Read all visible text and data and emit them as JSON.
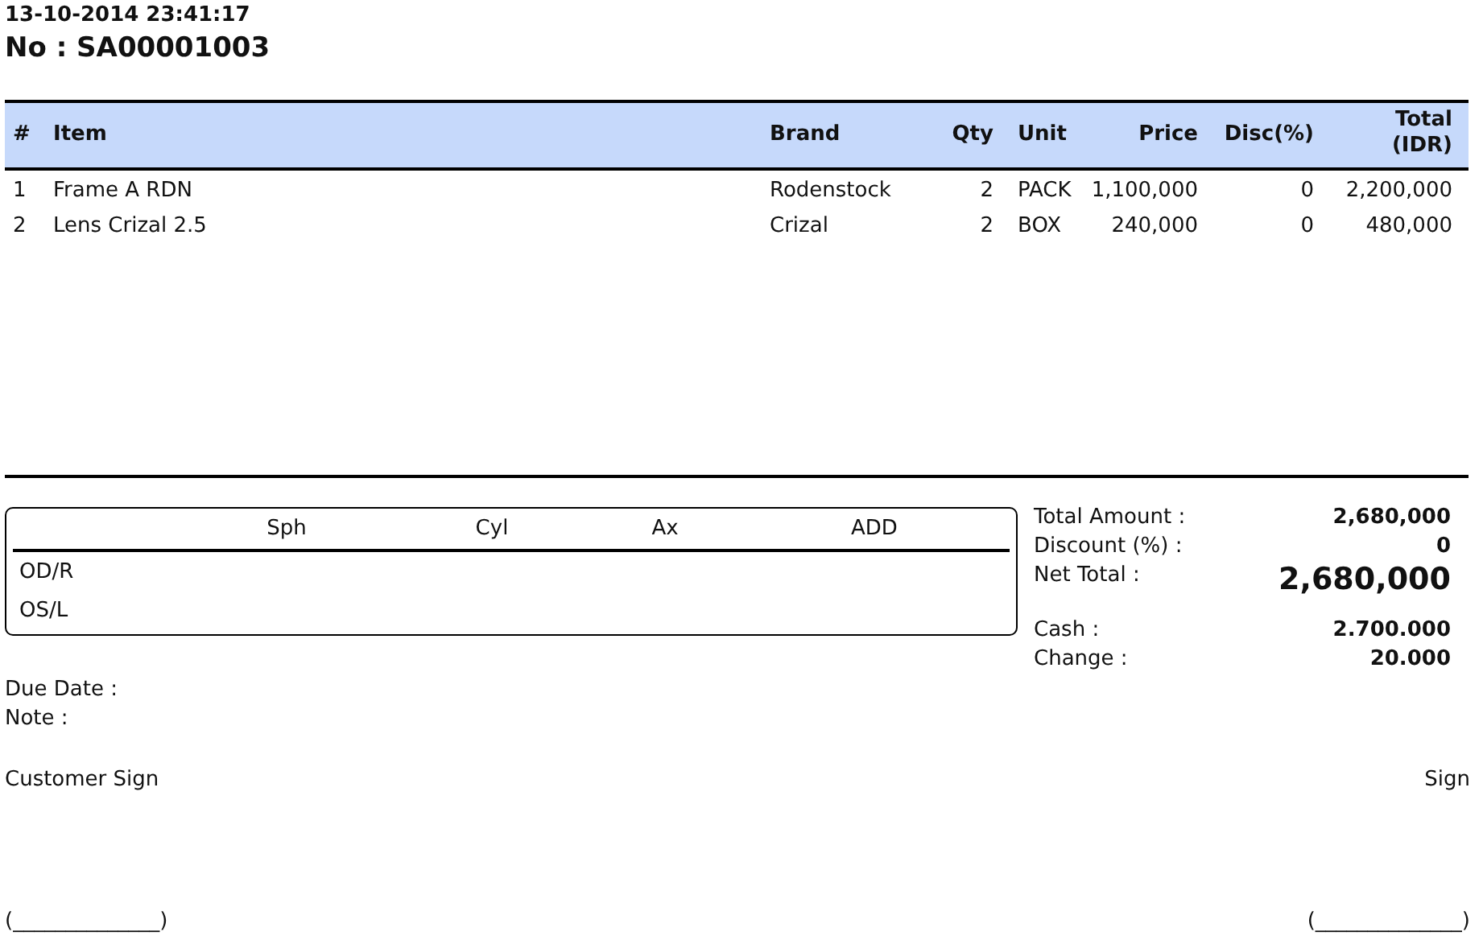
{
  "header": {
    "datetime": "13-10-2014 23:41:17",
    "number": "No : SA00001003"
  },
  "table": {
    "columns": [
      "#",
      "Item",
      "Brand",
      "Qty",
      "Unit",
      "Price",
      "Disc(%)",
      "Total (IDR)"
    ],
    "rows": [
      [
        "1",
        "Frame A RDN",
        "Rodenstock",
        "2",
        "PACK",
        "1,100,000",
        "0",
        "2,200,000"
      ],
      [
        "2",
        "Lens Crizal 2.5",
        "Crizal",
        "2",
        "BOX",
        "240,000",
        "0",
        "480,000"
      ]
    ]
  },
  "prescription": {
    "columns": [
      "Sph",
      "Cyl",
      "Ax",
      "ADD"
    ],
    "rows": [
      "OD/R",
      "OS/L"
    ]
  },
  "totals": [
    {
      "kind": "normal",
      "label": "Total Amount :",
      "value": "2,680,000"
    },
    {
      "kind": "normal",
      "label": "Discount (%) :",
      "value": "0"
    },
    {
      "kind": "large",
      "label": "Net Total :",
      "value": "2,680,000"
    },
    {
      "kind": "spaced",
      "label": "Cash :",
      "value": "2.700.000"
    },
    {
      "kind": "normal",
      "label": "Change :",
      "value": "20.000"
    }
  ],
  "notes": [
    "Due Date :",
    "Note :"
  ],
  "signatures": {
    "left_label": "Customer Sign",
    "right_label": "Sign",
    "left_line": "(______________)",
    "right_line": "(______________)"
  }
}
